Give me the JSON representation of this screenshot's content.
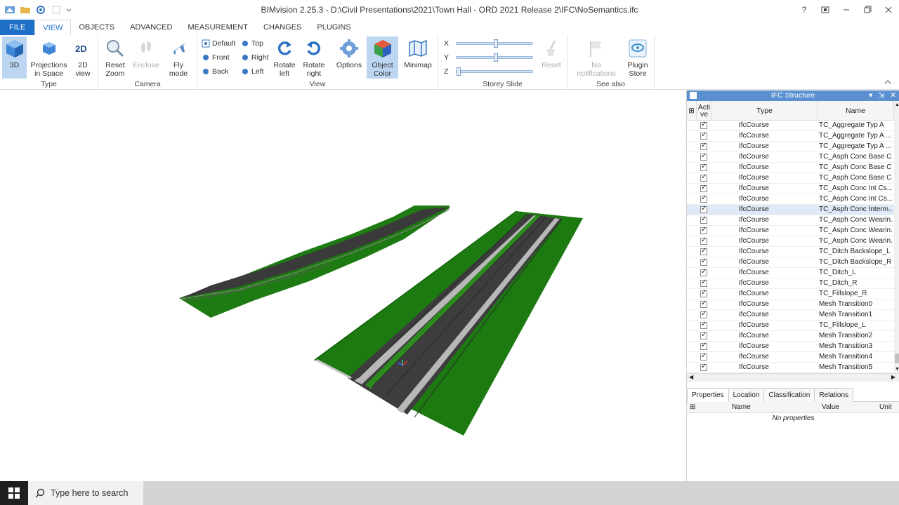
{
  "window": {
    "title": "BIMvision 2.25.3 - D:\\Civil Presentations\\2021\\Town Hall - ORD 2021 Release 2\\IFC\\NoSemantics.ifc",
    "help": "?"
  },
  "ribbon": {
    "tabs": [
      "FILE",
      "VIEW",
      "OBJECTS",
      "ADVANCED",
      "MEASUREMENT",
      "CHANGES",
      "PLUGINS"
    ],
    "active_tab": "VIEW",
    "groups": {
      "type": {
        "label": "Type",
        "btn_3d": "3D",
        "btn_projections_1": "Projections",
        "btn_projections_2": "in Space",
        "btn_2d_1": "2D",
        "btn_2d_2": "view"
      },
      "camera": {
        "label": "Camera",
        "reset_zoom_1": "Reset",
        "reset_zoom_2": "Zoom",
        "enclose": "Enclose",
        "fly_1": "Fly",
        "fly_2": "mode"
      },
      "view": {
        "label": "View",
        "default": "Default",
        "front": "Front",
        "back": "Back",
        "top": "Top",
        "right": "Right",
        "left": "Left",
        "rotate_left_1": "Rotate",
        "rotate_left_2": "left",
        "rotate_right_1": "Rotate",
        "rotate_right_2": "right",
        "options": "Options",
        "object_color_1": "Object",
        "object_color_2": "Color",
        "minimap": "Minimap"
      },
      "storey": {
        "label": "Storey Slide",
        "x": "X",
        "y": "Y",
        "z": "Z",
        "reset": "Reset"
      },
      "see_also": {
        "label": "See also",
        "notif_1": "No",
        "notif_2": "notifications",
        "plugin_1": "Plugin",
        "plugin_2": "Store"
      }
    }
  },
  "ifc_panel": {
    "title": "IFC Structure",
    "col_active_1": "Acti",
    "col_active_2": "ve",
    "col_type": "Type",
    "col_name": "Name",
    "rows": [
      {
        "type": "IfcCourse",
        "name": "TC_Aggregate Typ A"
      },
      {
        "type": "IfcCourse",
        "name": "TC_Aggregate Typ A ..."
      },
      {
        "type": "IfcCourse",
        "name": "TC_Aggregate Typ A ..."
      },
      {
        "type": "IfcCourse",
        "name": "TC_Asph Conc Base Cse"
      },
      {
        "type": "IfcCourse",
        "name": "TC_Asph Conc Base C..."
      },
      {
        "type": "IfcCourse",
        "name": "TC_Asph Conc Base C..."
      },
      {
        "type": "IfcCourse",
        "name": "TC_Asph Conc Int Cs..."
      },
      {
        "type": "IfcCourse",
        "name": "TC_Asph Conc Int Cs..."
      },
      {
        "type": "IfcCourse",
        "name": "TC_Asph Conc Interm..."
      },
      {
        "type": "IfcCourse",
        "name": "TC_Asph Conc Wearin..."
      },
      {
        "type": "IfcCourse",
        "name": "TC_Asph Conc Wearin..."
      },
      {
        "type": "IfcCourse",
        "name": "TC_Asph Conc Wearin..."
      },
      {
        "type": "IfcCourse",
        "name": "TC_Ditch Backslope_L"
      },
      {
        "type": "IfcCourse",
        "name": "TC_Ditch Backslope_R"
      },
      {
        "type": "IfcCourse",
        "name": "TC_Ditch_L"
      },
      {
        "type": "IfcCourse",
        "name": "TC_Ditch_R"
      },
      {
        "type": "IfcCourse",
        "name": "TC_Fillslope_R"
      },
      {
        "type": "IfcCourse",
        "name": "Mesh Transition0"
      },
      {
        "type": "IfcCourse",
        "name": "Mesh Transition1"
      },
      {
        "type": "IfcCourse",
        "name": "TC_Fillslope_L"
      },
      {
        "type": "IfcCourse",
        "name": "Mesh Transition2"
      },
      {
        "type": "IfcCourse",
        "name": "Mesh Transition3"
      },
      {
        "type": "IfcCourse",
        "name": "Mesh Transition4"
      },
      {
        "type": "IfcCourse",
        "name": "Mesh Transition5"
      }
    ],
    "selected_row": 8
  },
  "properties": {
    "tabs": [
      "Properties",
      "Location",
      "Classification",
      "Relations"
    ],
    "col_name": "Name",
    "col_value": "Value",
    "col_unit": "Unit",
    "empty": "No properties"
  },
  "taskbar": {
    "search_placeholder": "Type here to search"
  },
  "colors": {
    "accent": "#1e6fc7",
    "ground_green": "#1c7a10",
    "asphalt": "#3b3b3b",
    "panel_header": "#5a8fd0"
  }
}
